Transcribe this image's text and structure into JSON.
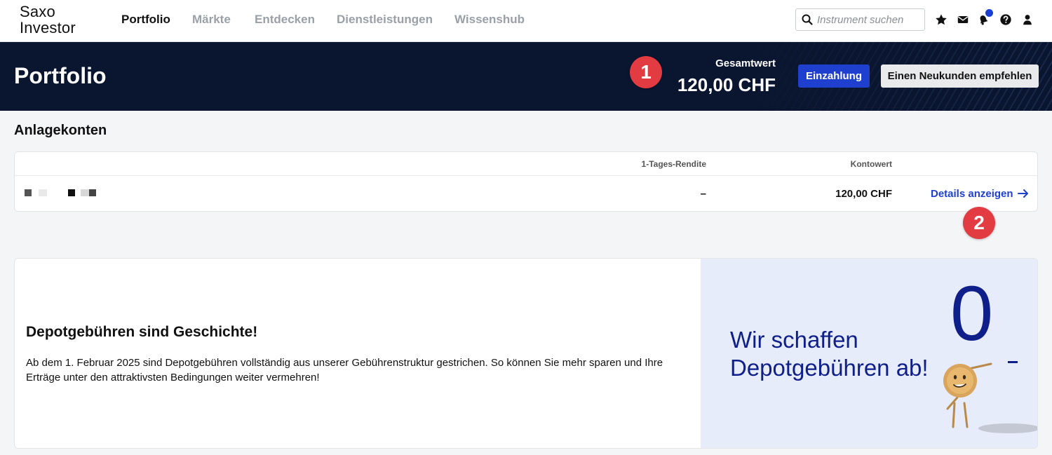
{
  "brand": {
    "line1": "Saxo",
    "line2": "Investor"
  },
  "nav": {
    "items": [
      {
        "label": "Portfolio",
        "active": true
      },
      {
        "label": "Märkte",
        "active": false
      },
      {
        "label": "Entdecken",
        "active": false
      },
      {
        "label": "Dienstleistungen",
        "active": false
      },
      {
        "label": "Wissenshub",
        "active": false
      }
    ]
  },
  "search": {
    "placeholder": "Instrument suchen",
    "value": ""
  },
  "toolbar_icons": [
    "star-icon",
    "mail-icon",
    "notifications-icon",
    "help-icon",
    "user-icon"
  ],
  "header": {
    "title": "Portfolio",
    "total_label": "Gesamtwert",
    "total_value": "120,00 CHF",
    "deposit_label": "Einzahlung",
    "refer_label": "Einen Neukunden empfehlen"
  },
  "markers": {
    "one": "1",
    "two": "2"
  },
  "accounts": {
    "section_title": "Anlagekonten",
    "columns": {
      "return_1d": "1-Tages-Rendite",
      "account_value": "Kontowert"
    },
    "rows": [
      {
        "return_1d": "–",
        "account_value": "120,00 CHF",
        "action_label": "Details anzeigen"
      }
    ]
  },
  "promo": {
    "title": "Depotgebühren sind Geschichte!",
    "text": "Ab dem 1. Februar 2025 sind Depotgebühren vollständig aus unserer Gebührenstruktur gestrichen. So können Sie mehr sparen und Ihre Erträge unter den attraktivsten Bedingungen weiter vermehren!",
    "headline_line1": "Wir schaffen",
    "headline_line2": "Depotgebühren ab!",
    "big_number": "0"
  },
  "colors": {
    "accent": "#1f3fcf",
    "banner_bg": "#0a1530",
    "marker": "#e23b42",
    "promo_bg": "#e7ecfb",
    "promo_text": "#0f1f8a"
  }
}
